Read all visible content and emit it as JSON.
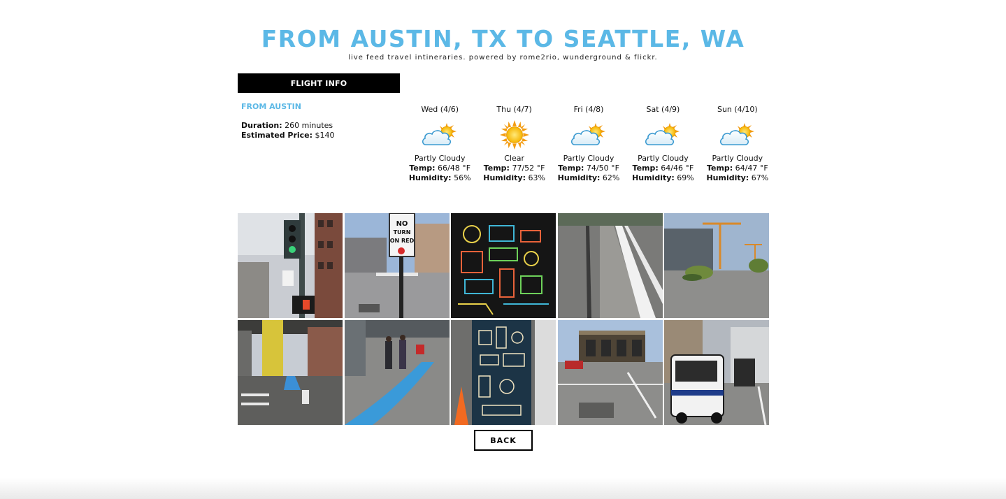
{
  "header": {
    "title": "FROM AUSTIN, TX TO SEATTLE, WA",
    "subtitle": "live feed travel intineraries. powered by rome2rio, wunderground & flickr."
  },
  "flight": {
    "bar_label": "FLIGHT INFO",
    "from_label": "FROM AUSTIN",
    "duration_label": "Duration:",
    "duration_value": " 260 minutes",
    "price_label": "Estimated Price:",
    "price_value": " $140"
  },
  "weather": [
    {
      "day": "Wed (4/6)",
      "icon": "partly-cloudy-icon",
      "condition": "Partly Cloudy",
      "temp_label": "Temp:",
      "temp": " 66/48 °F",
      "humidity_label": "Humidity:",
      "humidity": " 56%"
    },
    {
      "day": "Thu (4/7)",
      "icon": "sun-icon",
      "condition": "Clear",
      "temp_label": "Temp:",
      "temp": " 77/52 °F",
      "humidity_label": "Humidity:",
      "humidity": " 63%"
    },
    {
      "day": "Fri (4/8)",
      "icon": "partly-cloudy-icon",
      "condition": "Partly Cloudy",
      "temp_label": "Temp:",
      "temp": " 74/50 °F",
      "humidity_label": "Humidity:",
      "humidity": " 62%"
    },
    {
      "day": "Sat (4/9)",
      "icon": "partly-cloudy-icon",
      "condition": "Partly Cloudy",
      "temp_label": "Temp:",
      "temp": " 64/46 °F",
      "humidity_label": "Humidity:",
      "humidity": " 69%"
    },
    {
      "day": "Sun (4/10)",
      "icon": "partly-cloudy-icon",
      "condition": "Partly Cloudy",
      "temp_label": "Temp:",
      "temp": " 64/47 °F",
      "humidity_label": "Humidity:",
      "humidity": " 67%"
    }
  ],
  "photos": {
    "sign_text": "NO TURN ON RED"
  },
  "back_label": "BACK",
  "colors": {
    "accent": "#5bb8e6",
    "bar": "#000000"
  }
}
